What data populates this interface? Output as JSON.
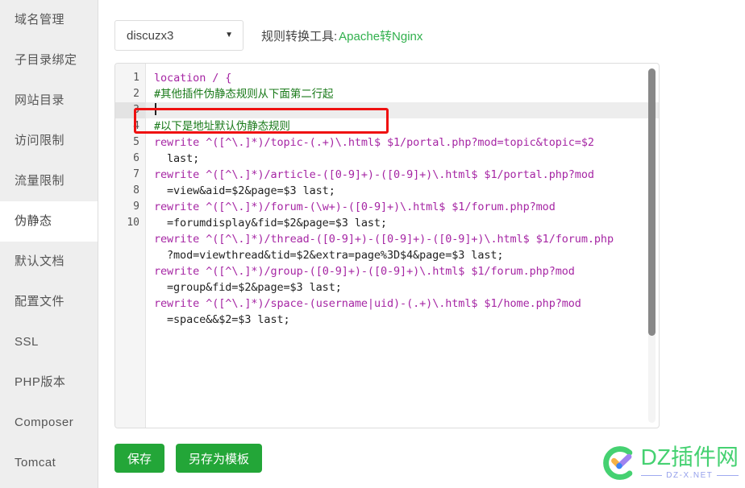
{
  "sidebar": {
    "items": [
      {
        "label": "域名管理",
        "active": false
      },
      {
        "label": "子目录绑定",
        "active": false
      },
      {
        "label": "网站目录",
        "active": false
      },
      {
        "label": "访问限制",
        "active": false
      },
      {
        "label": "流量限制",
        "active": false
      },
      {
        "label": "伪静态",
        "active": true
      },
      {
        "label": "默认文档",
        "active": false
      },
      {
        "label": "配置文件",
        "active": false
      },
      {
        "label": "SSL",
        "active": false
      },
      {
        "label": "PHP版本",
        "active": false
      },
      {
        "label": "Composer",
        "active": false
      },
      {
        "label": "Tomcat",
        "active": false
      }
    ]
  },
  "toolbar": {
    "select_value": "discuzx3",
    "select_caret": "▼",
    "converter_label": "规则转换工具:",
    "converter_link": "Apache转Nginx",
    "link_color": "#31b04d"
  },
  "editor": {
    "active_line": 3,
    "gutter_numbers": [
      "1",
      "2",
      "3",
      "4",
      "5",
      "",
      "6",
      "",
      "7",
      "",
      "8",
      "",
      "9",
      "",
      "10",
      ""
    ],
    "lines": [
      {
        "num": "1",
        "text": "location / {",
        "type": "code",
        "cont": false
      },
      {
        "num": "2",
        "text": "#其他插件伪静态规则从下面第二行起",
        "type": "comment",
        "cont": false
      },
      {
        "num": "3",
        "text": "",
        "type": "empty",
        "cont": false
      },
      {
        "num": "4",
        "text": "#以下是地址默认伪静态规则",
        "type": "comment",
        "cont": false
      },
      {
        "num": "5",
        "text": "rewrite ^([^\\.]*)/topic-(.+)\\.html$ $1/portal.php?mod=topic&topic=$2",
        "type": "rewrite",
        "cont": false
      },
      {
        "num": "",
        "text": "last;",
        "type": "plain",
        "cont": true
      },
      {
        "num": "6",
        "text": "rewrite ^([^\\.]*)/article-([0-9]+)-([0-9]+)\\.html$ $1/portal.php?mod",
        "type": "rewrite",
        "cont": false
      },
      {
        "num": "",
        "text": "=view&aid=$2&page=$3 last;",
        "type": "plain",
        "cont": true
      },
      {
        "num": "7",
        "text": "rewrite ^([^\\.]*)/forum-(\\w+)-([0-9]+)\\.html$ $1/forum.php?mod",
        "type": "rewrite",
        "cont": false
      },
      {
        "num": "",
        "text": "=forumdisplay&fid=$2&page=$3 last;",
        "type": "plain",
        "cont": true
      },
      {
        "num": "8",
        "text": "rewrite ^([^\\.]*)/thread-([0-9]+)-([0-9]+)-([0-9]+)\\.html$ $1/forum.php",
        "type": "rewrite",
        "cont": false
      },
      {
        "num": "",
        "text": "?mod=viewthread&tid=$2&extra=page%3D$4&page=$3 last;",
        "type": "plain",
        "cont": true
      },
      {
        "num": "9",
        "text": "rewrite ^([^\\.]*)/group-([0-9]+)-([0-9]+)\\.html$ $1/forum.php?mod",
        "type": "rewrite",
        "cont": false
      },
      {
        "num": "",
        "text": "=group&fid=$2&page=$3 last;",
        "type": "plain",
        "cont": true
      },
      {
        "num": "10",
        "text": "rewrite ^([^\\.]*)/space-(username|uid)-(.+)\\.html$ $1/home.php?mod",
        "type": "rewrite",
        "cont": false
      },
      {
        "num": "",
        "text": "=space&&$2=$3 last;",
        "type": "plain",
        "cont": true
      }
    ],
    "syntax_colors": {
      "keyword": "#a626a4",
      "comment": "#1a7a1a",
      "text": "#222222"
    },
    "scrollbar": {
      "thumb_fraction": "0.75"
    }
  },
  "buttons": [
    {
      "label": "保存",
      "name": "save-button"
    },
    {
      "label": "另存为模板",
      "name": "save-as-template-button"
    }
  ],
  "watermark": {
    "title": "DZ插件网",
    "subtitle": "DZ-X.NET",
    "title_color": "#3ccf6a",
    "subtitle_color": "#8f9bea"
  }
}
